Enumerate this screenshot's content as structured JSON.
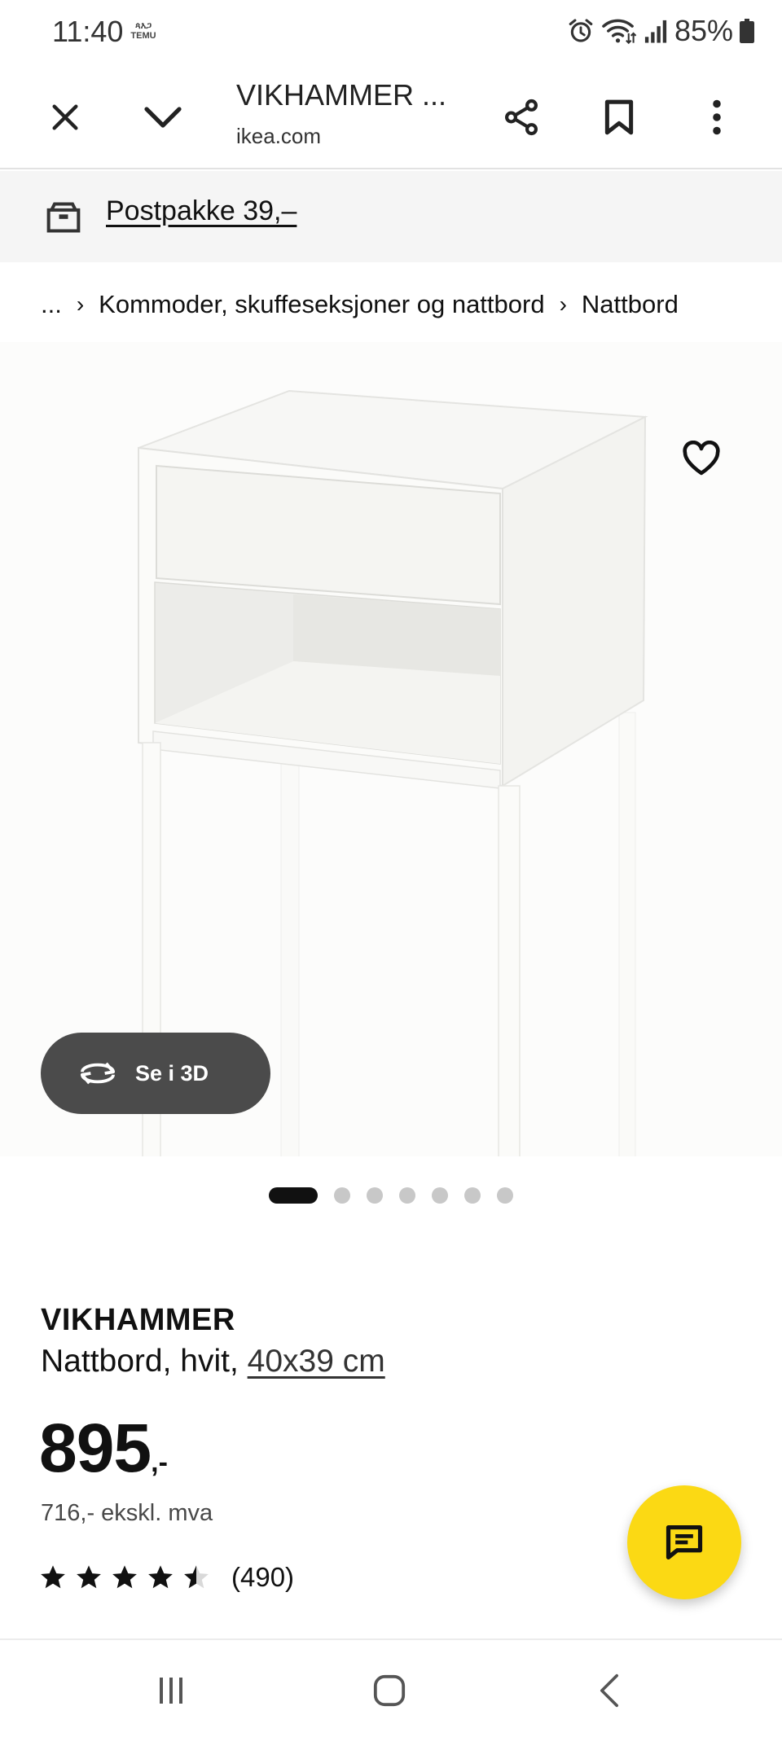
{
  "status_bar": {
    "time": "11:40",
    "temu_badge": "ጳእጋ TEMU",
    "battery": "85%"
  },
  "browser": {
    "title": "VIKHAMMER ...",
    "domain": "ikea.com"
  },
  "banner": {
    "text": "Postpakke 39,–"
  },
  "breadcrumb": {
    "items": [
      "...",
      "Kommoder, skuffeseksjoner og nattbord",
      "Nattbord"
    ]
  },
  "product": {
    "view_3d_label": "Se i 3D",
    "image_count": 7,
    "active_image": 1,
    "brand": "VIKHAMMER",
    "description": "Nattbord, hvit,",
    "size": "40x39 cm",
    "price": "895",
    "price_suffix": ",-",
    "price_ex_vat": "716,- ekskl. mva",
    "rating": 4.5,
    "rating_max": 5,
    "rating_count": "(490)"
  },
  "colors": {
    "chat_fab": "#fbd914",
    "banner_bg": "#f5f5f5",
    "view3d_bg": "#4b4b4b"
  },
  "icons": {
    "close": "close-icon",
    "collapse": "chevron-down-icon",
    "share": "share-icon",
    "bookmark": "bookmark-icon",
    "menu": "more-vert-icon",
    "delivery": "box-icon",
    "favourite": "heart-icon",
    "rotate_3d": "rotate-3d-icon",
    "chat": "chat-icon"
  }
}
